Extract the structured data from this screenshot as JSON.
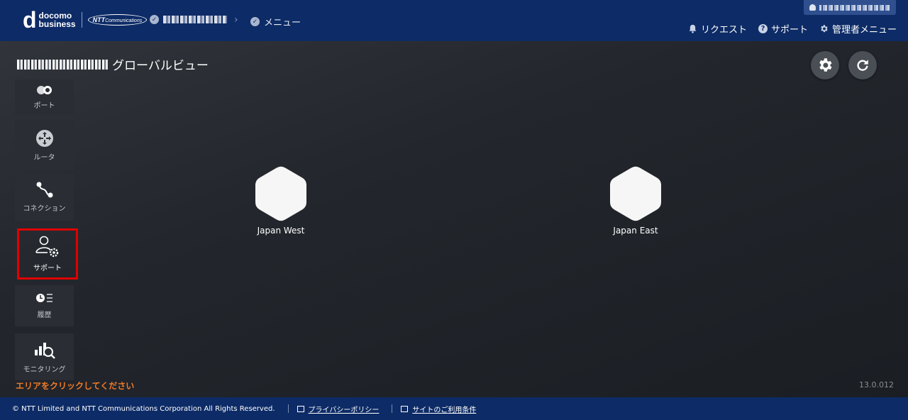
{
  "header": {
    "brand_line1": "docomo",
    "brand_line2": "business",
    "partner_logo": "NTT",
    "partner_logo_sub": "Communications",
    "breadcrumb_menu": "メニュー",
    "nav": {
      "request": "リクエスト",
      "support": "サポート",
      "admin_menu": "管理者メニュー"
    }
  },
  "page": {
    "title_suffix": "グローバルビュー"
  },
  "sidebar": {
    "items": [
      {
        "label": "ポート",
        "icon": "port-icon"
      },
      {
        "label": "ルータ",
        "icon": "router-icon"
      },
      {
        "label": "コネクション",
        "icon": "connection-icon"
      },
      {
        "label": "サポート",
        "icon": "support-user-gear-icon"
      },
      {
        "label": "履歴",
        "icon": "history-icon"
      },
      {
        "label": "モニタリング",
        "icon": "monitoring-icon"
      }
    ]
  },
  "regions": [
    {
      "label": "Japan West"
    },
    {
      "label": "Japan East"
    }
  ],
  "hint": "エリアをクリックしてください",
  "version": "13.0.012",
  "footer": {
    "copyright": "© NTT Limited and NTT Communications Corporation All Rights Reserved.",
    "privacy": "プライバシーポリシー",
    "terms": "サイトのご利用条件"
  },
  "colors": {
    "header_bg": "#0d2b66",
    "highlight": "#e00000",
    "hint": "#f07a28"
  }
}
